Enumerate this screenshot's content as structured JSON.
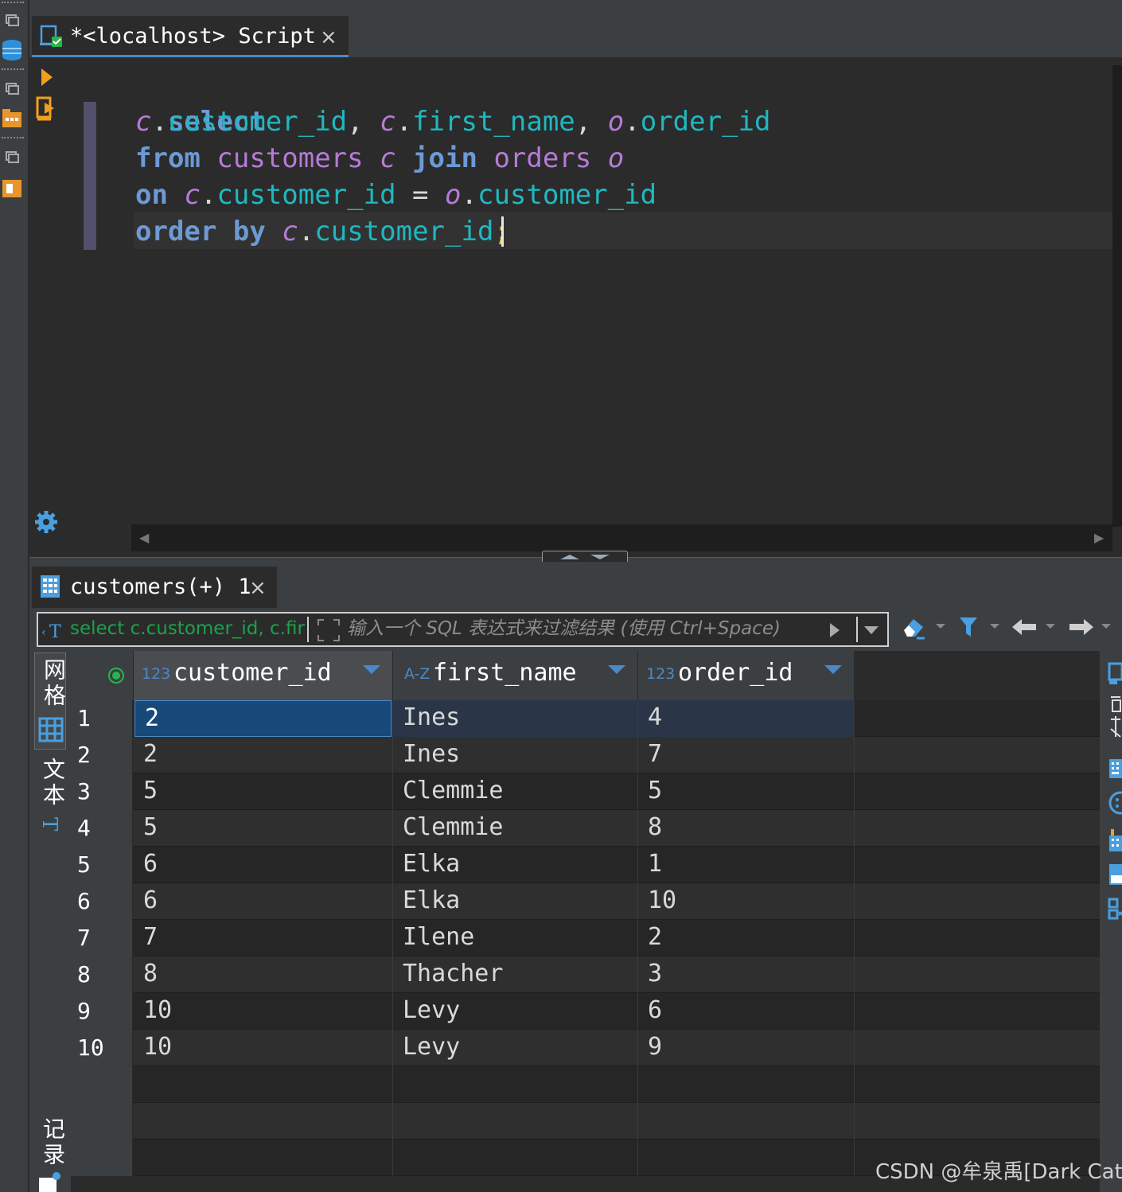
{
  "editor_tab": {
    "title": "*<localhost> Script",
    "close": "×"
  },
  "editor": {
    "lines": [
      {
        "kw1": "select"
      },
      {
        "a1": "c",
        "p1": ".",
        "c1": "customer_id",
        "p2": ", ",
        "a2": "c",
        "p3": ".",
        "c2": "first_name",
        "p4": ", ",
        "a3": "o",
        "p5": ".",
        "c3": "order_id"
      },
      {
        "kw1": "from",
        "t1": "customers",
        "a1": "c",
        "kw2": "join",
        "t2": "orders",
        "a2": "o"
      },
      {
        "kw1": "on",
        "a1": "c",
        "p1": ".",
        "c1": "customer_id",
        "p2": " = ",
        "a2": "o",
        "p3": ".",
        "c2": "customer_id"
      },
      {
        "kw1": "order",
        "kw2": "by",
        "a1": "c",
        "p1": ".",
        "c1": "customer_id",
        "semi": ";"
      }
    ]
  },
  "results_tab": {
    "title": "customers(+) 1",
    "close": "×"
  },
  "filter": {
    "sql_preview": "select c.customer_id, c.firs",
    "placeholder": "输入一个 SQL 表达式来过滤结果 (使用 Ctrl+Space)"
  },
  "side_tabs": {
    "grid": "网格",
    "text": "文本",
    "record": "记录"
  },
  "grid": {
    "columns": [
      {
        "type": "123",
        "name": "customer_id"
      },
      {
        "type": "A-Z",
        "name": "first_name"
      },
      {
        "type": "123",
        "name": "order_id"
      }
    ],
    "rows": [
      {
        "n": "1",
        "customer_id": "2",
        "first_name": "Ines",
        "order_id": "4"
      },
      {
        "n": "2",
        "customer_id": "2",
        "first_name": "Ines",
        "order_id": "7"
      },
      {
        "n": "3",
        "customer_id": "5",
        "first_name": "Clemmie",
        "order_id": "5"
      },
      {
        "n": "4",
        "customer_id": "5",
        "first_name": "Clemmie",
        "order_id": "8"
      },
      {
        "n": "5",
        "customer_id": "6",
        "first_name": "Elka",
        "order_id": "1"
      },
      {
        "n": "6",
        "customer_id": "6",
        "first_name": "Elka",
        "order_id": "10"
      },
      {
        "n": "7",
        "customer_id": "7",
        "first_name": "Ilene",
        "order_id": "2"
      },
      {
        "n": "8",
        "customer_id": "8",
        "first_name": "Thacher",
        "order_id": "3"
      },
      {
        "n": "9",
        "customer_id": "10",
        "first_name": "Levy",
        "order_id": "6"
      },
      {
        "n": "10",
        "customer_id": "10",
        "first_name": "Levy",
        "order_id": "9"
      }
    ]
  },
  "watermark": "CSDN @牟泉禹[Dark Cat]",
  "colors": {
    "accent": "#4a88c7",
    "keyword": "#6c9ad6",
    "alias": "#b57bd6",
    "column": "#1fb8c1",
    "selection": "#174a7a"
  }
}
